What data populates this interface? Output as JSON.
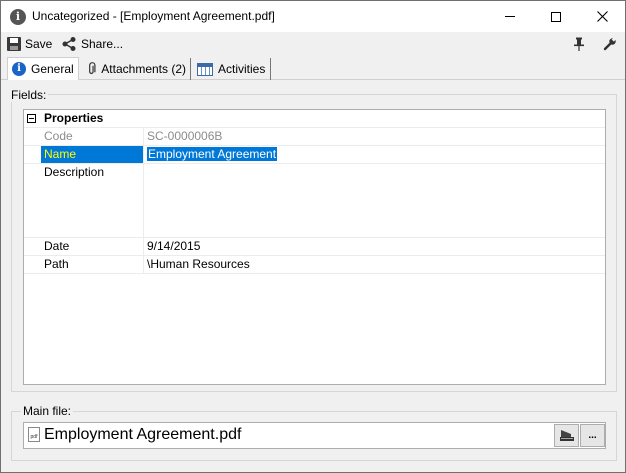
{
  "window": {
    "title": "Uncategorized - [Employment Agreement.pdf]"
  },
  "toolbar": {
    "save_label": "Save",
    "share_label": "Share..."
  },
  "tabs": [
    {
      "label": "General",
      "icon": "info-icon",
      "active": true
    },
    {
      "label": "Attachments (2)",
      "icon": "paperclip-icon",
      "active": false
    },
    {
      "label": "Activities",
      "icon": "calendar-icon",
      "active": false
    }
  ],
  "fields": {
    "group_label": "Fields:",
    "category": "Properties",
    "rows": [
      {
        "name": "Code",
        "value": "SC-0000006B",
        "readonly": true
      },
      {
        "name": "Name",
        "value": "Employment Agreement",
        "selected": true
      },
      {
        "name": "Description",
        "value": ""
      },
      {
        "name": "Date",
        "value": "9/14/2015"
      },
      {
        "name": "Path",
        "value": "\\Human Resources"
      }
    ]
  },
  "main_file": {
    "group_label": "Main file:",
    "file_name": "Employment Agreement.pdf",
    "file_icon_text": "pdf",
    "more_label": "..."
  },
  "colors": {
    "selection": "#0078d7",
    "selection_name_text": "#ffff00",
    "accent": "#1b64c7"
  }
}
